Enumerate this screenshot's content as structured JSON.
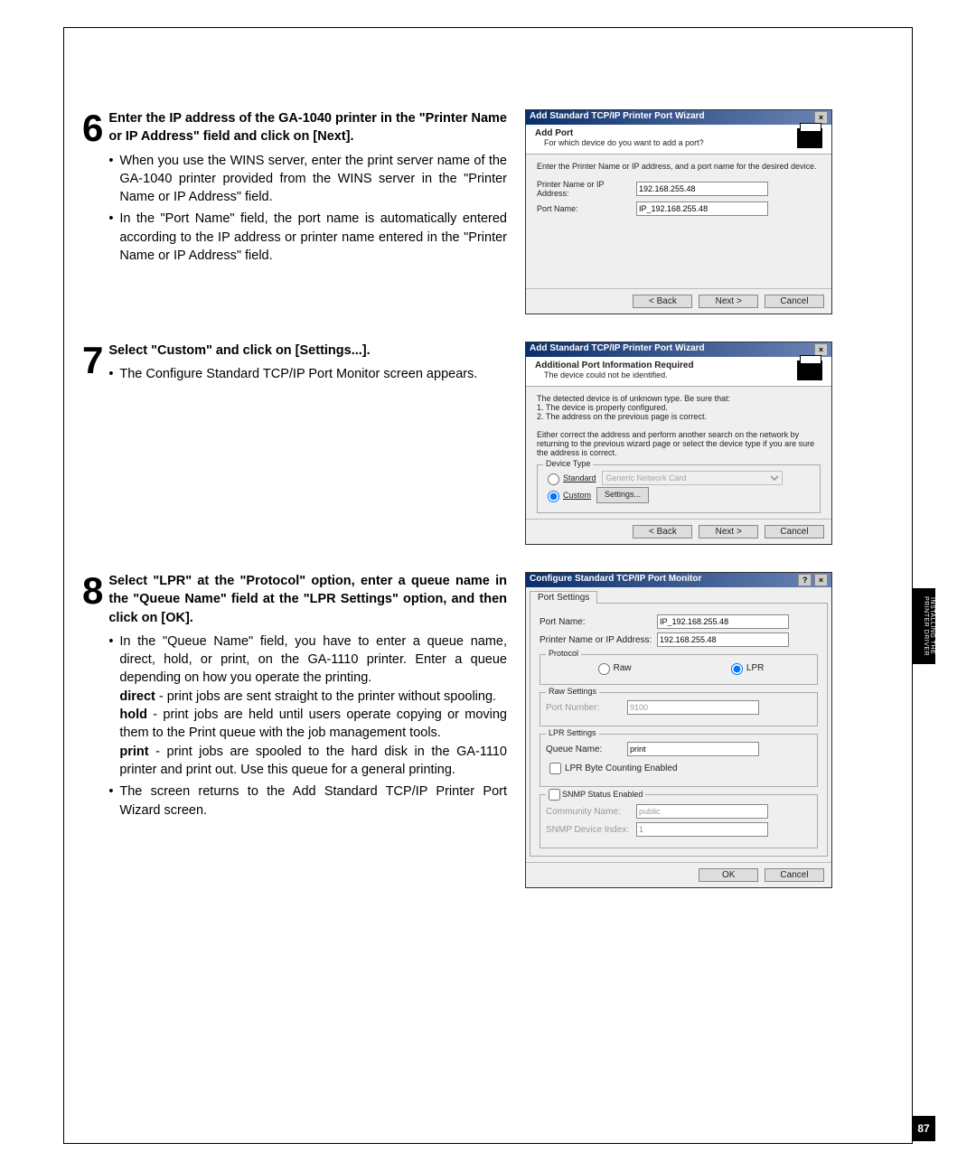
{
  "step6": {
    "num": "6",
    "heading": "Enter the IP address of the GA-1040 printer in the \"Printer Name or IP Address\" field and click on [Next].",
    "b1": "When you use the WINS server, enter the print server name of the GA-1040 printer provided from the WINS server in the \"Printer Name or IP Address\" field.",
    "b2": "In the \"Port Name\" field, the port name is automatically entered according to the IP address or printer name entered in the \"Printer Name or IP Address\" field."
  },
  "dlg6": {
    "title": "Add Standard TCP/IP Printer Port Wizard",
    "bannerTitle": "Add Port",
    "bannerSub": "For which device do you want to add a port?",
    "instr": "Enter the Printer Name or IP address, and a port name for the desired device.",
    "row1": "Printer Name or IP Address:",
    "row1v": "192.168.255.48",
    "row2": "Port Name:",
    "row2v": "IP_192.168.255.48",
    "back": "< Back",
    "next": "Next >",
    "cancel": "Cancel"
  },
  "step7": {
    "num": "7",
    "heading": "Select \"Custom\" and click on [Settings...].",
    "b1": "The Configure Standard TCP/IP Port Monitor screen appears."
  },
  "dlg7": {
    "title": "Add Standard TCP/IP Printer Port Wizard",
    "bannerTitle": "Additional Port Information Required",
    "bannerSub": "The device could not be identified.",
    "body": "The detected device is of unknown type.  Be sure that:\n1.  The device is properly configured.\n2.  The address on the previous page is correct.\n\nEither correct the address and perform another search on the network by returning to the previous wizard page or select the device type if you are sure the address is correct.",
    "group": "Device Type",
    "std": "Standard",
    "stdv": "Generic Network Card",
    "cust": "Custom",
    "settings": "Settings...",
    "back": "< Back",
    "next": "Next >",
    "cancel": "Cancel"
  },
  "step8": {
    "num": "8",
    "heading": "Select \"LPR\" at the \"Protocol\" option, enter a queue name in the \"Queue Name\" field at the \"LPR Settings\" option, and then click on [OK].",
    "b1": "In the \"Queue Name\" field, you have to enter a queue name, direct, hold, or print, on the GA-1110 printer.  Enter a queue depending on how you operate the printing.",
    "d1b": "direct",
    "d1": " - print jobs are sent straight to the printer without spooling.",
    "d2b": "hold",
    "d2": " - print jobs are held until users operate copying or moving them to the Print queue with the job management tools.",
    "d3b": "print",
    "d3": " - print jobs are spooled to the hard disk in the GA-1110 printer and print out.  Use this queue for a general printing.",
    "b2": "The screen returns to the Add Standard TCP/IP Printer Port Wizard screen."
  },
  "dlg8": {
    "title": "Configure Standard TCP/IP Port Monitor",
    "tab": "Port Settings",
    "r1": "Port Name:",
    "r1v": "IP_192.168.255.48",
    "r2": "Printer Name or IP Address:",
    "r2v": "192.168.255.48",
    "protocol": "Protocol",
    "raw": "Raw",
    "lpr": "LPR",
    "rawGroup": "Raw Settings",
    "portNum": "Port Number:",
    "portNumV": "9100",
    "lprGroup": "LPR Settings",
    "queue": "Queue Name:",
    "queueV": "print",
    "byteCount": "LPR Byte Counting Enabled",
    "snmpGroup": "SNMP Status Enabled",
    "comm": "Community Name:",
    "commV": "public",
    "snmpIdx": "SNMP Device Index:",
    "snmpIdxV": "1",
    "ok": "OK",
    "cancel": "Cancel"
  },
  "sideTab": "INSTALLING THE PRINTER DRIVER",
  "pageNum": "87",
  "titleHelp": "?",
  "titleClose": "×"
}
